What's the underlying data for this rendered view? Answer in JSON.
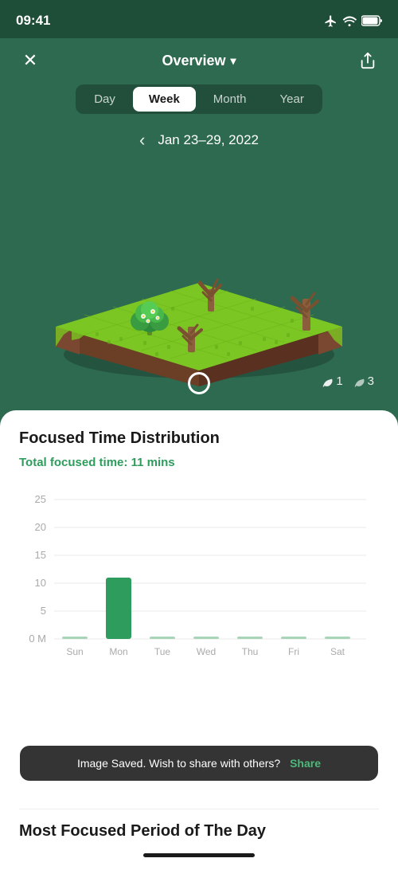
{
  "statusBar": {
    "time": "09:41"
  },
  "header": {
    "title": "Overview",
    "closeIcon": "✕",
    "chevron": "▾",
    "shareLabel": "share"
  },
  "tabs": [
    {
      "label": "Day",
      "id": "day",
      "active": false
    },
    {
      "label": "Week",
      "id": "week",
      "active": true
    },
    {
      "label": "Month",
      "id": "month",
      "active": false
    },
    {
      "label": "Year",
      "id": "year",
      "active": false
    }
  ],
  "dateNav": {
    "range": "Jan 23–29, 2022",
    "prevArrow": "‹"
  },
  "garden": {
    "aliveCount": "1",
    "deadCount": "3"
  },
  "focusedTime": {
    "sectionTitle": "Focused Time Distribution",
    "totalLabel": "Total focused time:",
    "totalValue": "11",
    "unit": "mins"
  },
  "chart": {
    "yLabels": [
      "25",
      "20",
      "15",
      "10",
      "5",
      "0 M"
    ],
    "xLabels": [
      "Sun",
      "Mon",
      "Tue",
      "Wed",
      "Thu",
      "Fri",
      "Sat"
    ],
    "bars": [
      0,
      11,
      0,
      0,
      0,
      0,
      0
    ],
    "maxValue": 25,
    "color": "#2d9c5c",
    "dimColor": "#a8d5b8"
  },
  "toast": {
    "message": "Image Saved. Wish to share with others?",
    "actionLabel": "Share"
  },
  "mostFocused": {
    "title": "Most Focused Period of The Day"
  },
  "colors": {
    "primary": "#2d6a4f",
    "accent": "#2d9c5c",
    "background": "#2d6a4f",
    "cardBg": "#ffffff"
  }
}
